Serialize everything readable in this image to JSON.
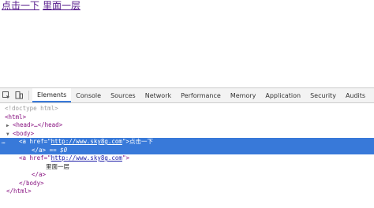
{
  "page": {
    "link1": "点击一下",
    "link2": "里面一层"
  },
  "devtools": {
    "tabs": [
      "Elements",
      "Console",
      "Sources",
      "Network",
      "Performance",
      "Memory",
      "Application",
      "Security",
      "Audits"
    ],
    "active_tab": "Elements",
    "dom": {
      "doctype": "<!doctype html>",
      "html_open": "<html>",
      "head": "<head>…</head>",
      "body_open": "<body>",
      "a1_open_pre": "<a href=\"",
      "a1_href": "http://www.sky8g.com",
      "a1_open_post": "\">",
      "a1_text": "点击一下",
      "a1_close": "</a>",
      "a1_eq": " == $0",
      "a2_open_pre": "<a href=\"",
      "a2_href": "http://www.sky8g.com",
      "a2_open_post": "\">",
      "a2_text": "里面一层",
      "a2_close": "</a>",
      "body_close": "</body>",
      "html_close": "</html>"
    }
  },
  "colors": {
    "selection": "#3879d9",
    "tag": "#881280",
    "link": "#551a8b"
  }
}
